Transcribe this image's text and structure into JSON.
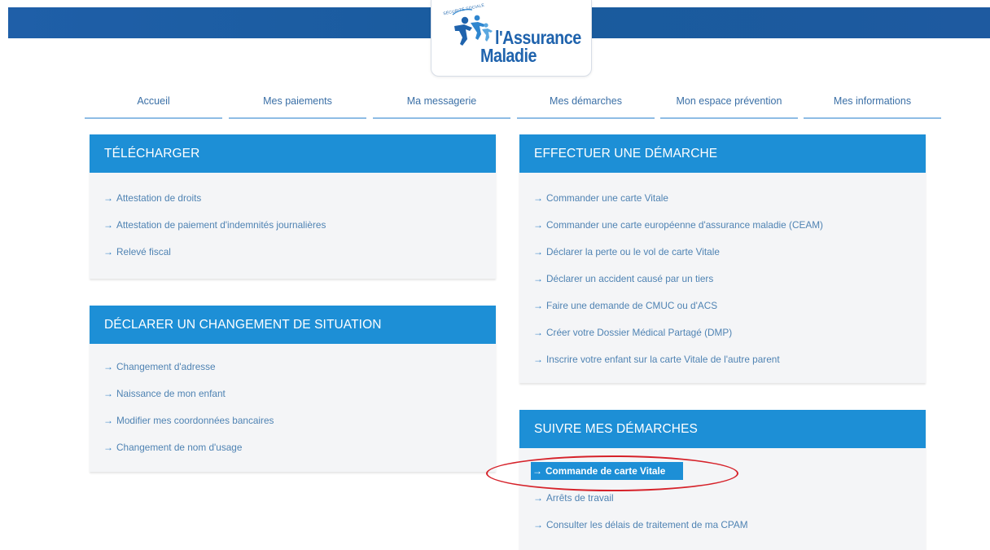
{
  "brand": {
    "name_line1": "l'Assurance",
    "name_line2": "Maladie",
    "tagline": "SÉCURITÉ SOCIALE",
    "color": "#1f63ad",
    "band_color": "#1d5da3"
  },
  "nav": {
    "items": [
      {
        "label": "Accueil"
      },
      {
        "label": "Mes paiements"
      },
      {
        "label": "Ma messagerie"
      },
      {
        "label": "Mes démarches",
        "active": true
      },
      {
        "label": "Mon espace prévention"
      },
      {
        "label": "Mes informations"
      }
    ]
  },
  "panels": {
    "telecharger": {
      "title": "TÉLÉCHARGER",
      "links": [
        "Attestation de droits",
        "Attestation de paiement d'indemnités journalières",
        "Relevé fiscal"
      ]
    },
    "changement": {
      "title": "DÉCLARER UN CHANGEMENT DE SITUATION",
      "links": [
        "Changement d'adresse",
        "Naissance de mon enfant",
        "Modifier mes coordonnées bancaires",
        "Changement de nom d'usage"
      ]
    },
    "demarche": {
      "title": "EFFECTUER UNE DÉMARCHE",
      "links": [
        "Commander une carte Vitale",
        "Commander une carte européenne d'assurance maladie (CEAM)",
        "Déclarer la perte ou le vol de carte Vitale",
        "Déclarer un accident causé par un tiers",
        "Faire une demande de CMUC ou d'ACS",
        "Créer votre Dossier Médical Partagé (DMP)",
        "Inscrire votre enfant sur la carte Vitale de l'autre parent"
      ]
    },
    "suivre": {
      "title": "SUIVRE MES DÉMARCHES",
      "links": [
        "Commande de carte Vitale",
        "Arrêts de travail",
        "Consulter les délais de traitement de ma CPAM"
      ],
      "selected_index": 0
    }
  },
  "colors": {
    "header_blue": "#1d8fd6",
    "link_blue": "#4f83b3",
    "highlight_oval": "#d6222a"
  },
  "icons": {
    "link_arrow": "right-arrow-icon",
    "logo": "family-logo-icon"
  }
}
